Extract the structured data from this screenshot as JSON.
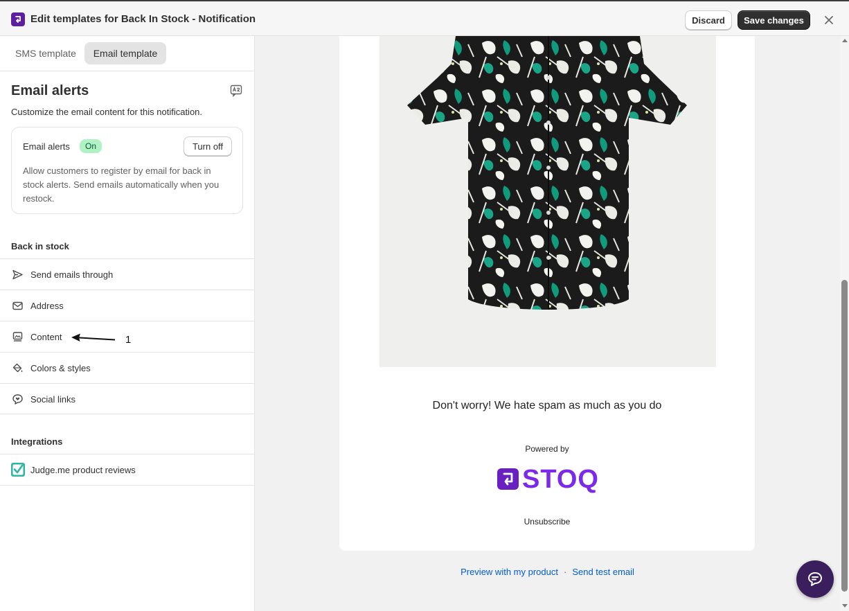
{
  "topbar": {
    "title": "Edit templates for Back In Stock - Notification",
    "discard_label": "Discard",
    "save_label": "Save changes",
    "logo_icon": "stoq-logo-icon",
    "close_icon": "close-icon"
  },
  "tabs": [
    {
      "label": "SMS template",
      "active": false
    },
    {
      "label": "Email template",
      "active": true
    }
  ],
  "email_alerts": {
    "title": "Email alerts",
    "description": "Customize the email content for this notification.",
    "card": {
      "label": "Email alerts",
      "status": "On",
      "toggle_label": "Turn off",
      "body": "Allow customers to register by email for back in stock alerts. Send emails automatically when you restock."
    }
  },
  "back_in_stock": {
    "heading": "Back in stock",
    "items": [
      {
        "label": "Send emails through",
        "icon": "send-icon"
      },
      {
        "label": "Address",
        "icon": "envelope-icon"
      },
      {
        "label": "Content",
        "icon": "image-content-icon"
      },
      {
        "label": "Colors & styles",
        "icon": "paint-bucket-icon"
      },
      {
        "label": "Social links",
        "icon": "chat-heart-icon"
      }
    ]
  },
  "integrations": {
    "heading": "Integrations",
    "items": [
      {
        "label": "Judge.me product reviews",
        "icon": "judgeme-icon"
      }
    ]
  },
  "annotation": {
    "number": "1"
  },
  "email_preview": {
    "tagline": "Don't worry! We hate spam as much as you do",
    "powered_by": "Powered by",
    "brand_name": "STOQ",
    "unsubscribe": "Unsubscribe"
  },
  "preview_links": {
    "preview_label": "Preview with my product",
    "separator": "·",
    "test_label": "Send test email"
  },
  "colors": {
    "brand_purple": "#7c2ae8",
    "primary_button": "#303030",
    "badge_green": "#aff3c4",
    "link_blue": "#005bd3"
  }
}
